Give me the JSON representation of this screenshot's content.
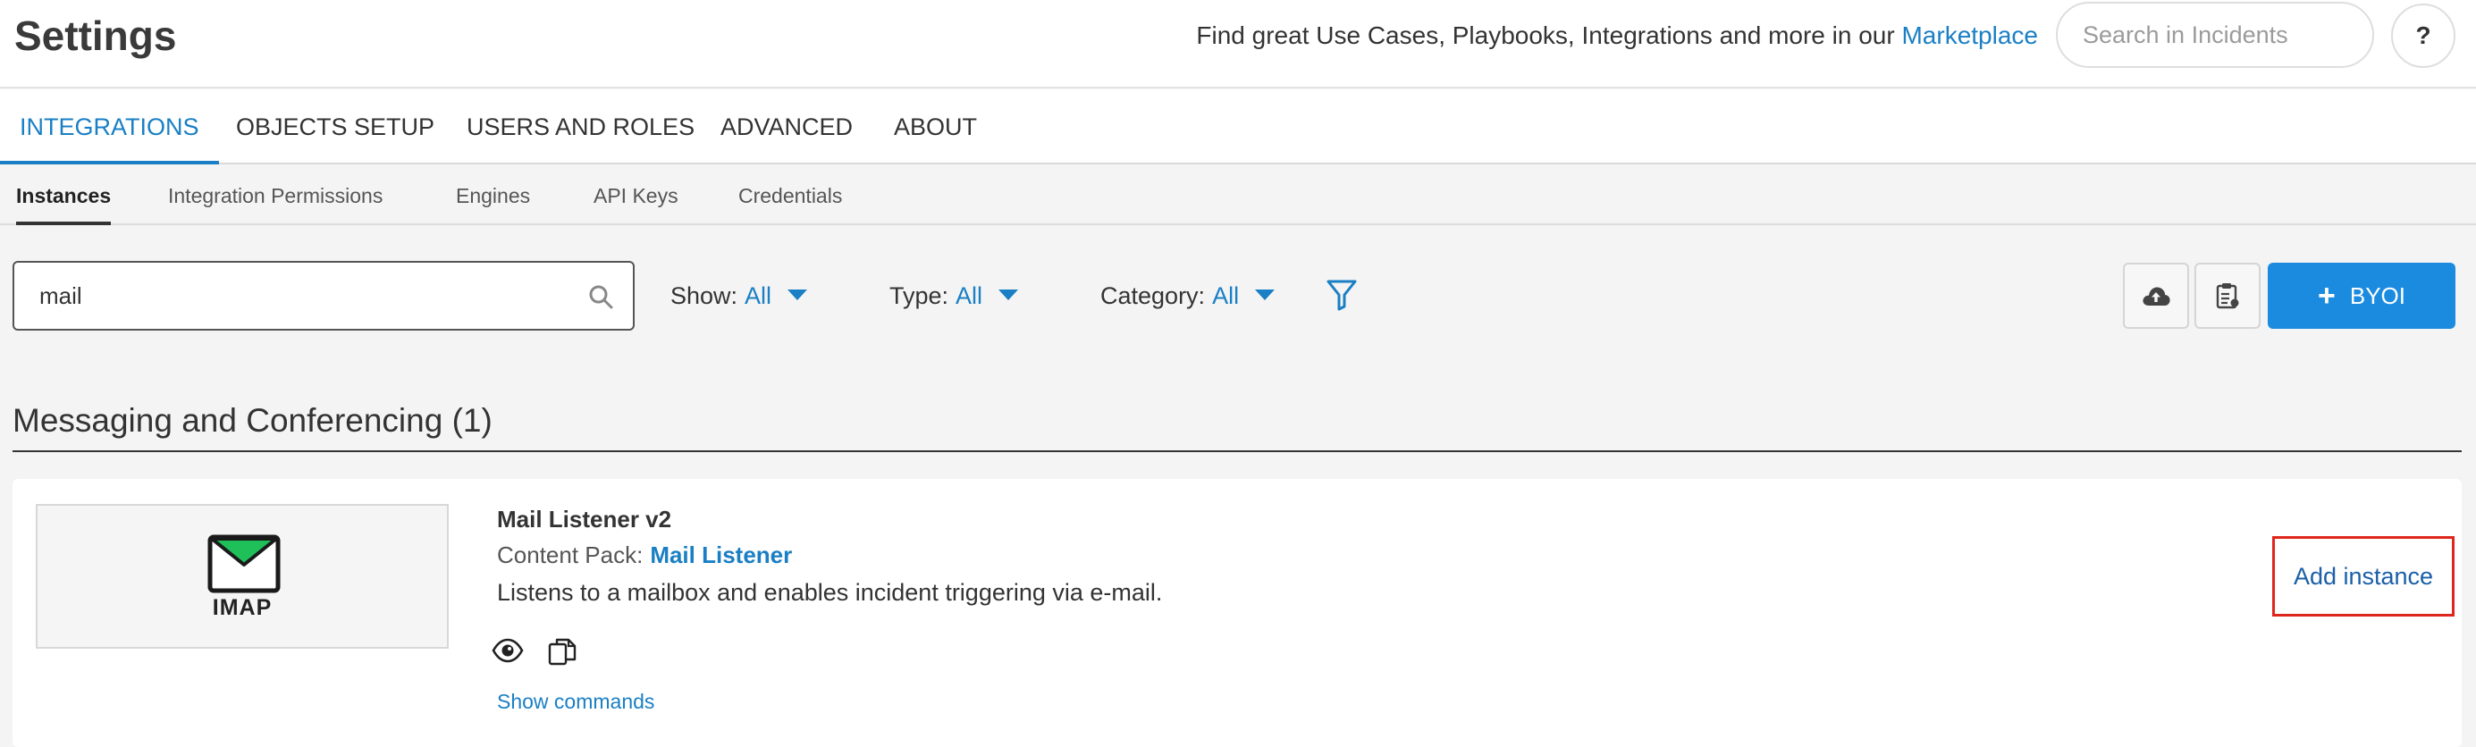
{
  "header": {
    "title": "Settings",
    "promo_text": "Find great Use Cases, Playbooks, Integrations and more in our ",
    "promo_link": "Marketplace",
    "search_placeholder": "Search in Incidents",
    "help_label": "?"
  },
  "main_tabs": [
    {
      "label": "INTEGRATIONS",
      "active": true
    },
    {
      "label": "OBJECTS SETUP",
      "active": false
    },
    {
      "label": "USERS AND ROLES",
      "active": false
    },
    {
      "label": "ADVANCED",
      "active": false
    },
    {
      "label": "ABOUT",
      "active": false
    }
  ],
  "sub_tabs": [
    {
      "label": "Instances",
      "active": true
    },
    {
      "label": "Integration Permissions",
      "active": false
    },
    {
      "label": "Engines",
      "active": false
    },
    {
      "label": "API Keys",
      "active": false
    },
    {
      "label": "Credentials",
      "active": false
    }
  ],
  "filters": {
    "search_value": "mail",
    "show": {
      "label": "Show:",
      "value": "All"
    },
    "type": {
      "label": "Type:",
      "value": "All"
    },
    "category": {
      "label": "Category:",
      "value": "All"
    }
  },
  "toolbar": {
    "upload_icon": "cloud-upload-icon",
    "report_icon": "clipboard-icon",
    "byoi_label": "BYOI",
    "byoi_plus": "+"
  },
  "section": {
    "title": "Messaging and Conferencing (1)"
  },
  "integration": {
    "logo_text": "IMAP",
    "name": "Mail Listener v2",
    "content_pack_label": "Content Pack:",
    "content_pack_value": "Mail Listener",
    "description": "Listens to a mailbox and enables incident triggering via e-mail.",
    "show_commands": "Show commands",
    "add_instance": "Add instance"
  },
  "colors": {
    "accent": "#1a7fc4",
    "byoi": "#1b8be0",
    "highlight": "#e0261c",
    "envelope": "#1fbf5a"
  }
}
